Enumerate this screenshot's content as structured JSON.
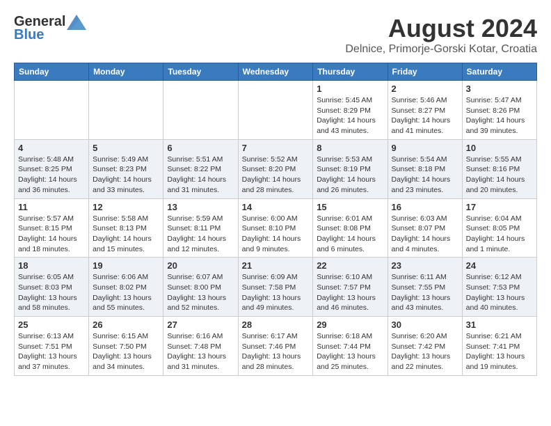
{
  "header": {
    "logo": {
      "general": "General",
      "blue": "Blue"
    },
    "title": "August 2024",
    "location": "Delnice, Primorje-Gorski Kotar, Croatia"
  },
  "days_of_week": [
    "Sunday",
    "Monday",
    "Tuesday",
    "Wednesday",
    "Thursday",
    "Friday",
    "Saturday"
  ],
  "weeks": [
    {
      "days": [
        {
          "date": "",
          "info": ""
        },
        {
          "date": "",
          "info": ""
        },
        {
          "date": "",
          "info": ""
        },
        {
          "date": "",
          "info": ""
        },
        {
          "date": "1",
          "sunrise": "Sunrise: 5:45 AM",
          "sunset": "Sunset: 8:29 PM",
          "daylight": "Daylight: 14 hours and 43 minutes."
        },
        {
          "date": "2",
          "sunrise": "Sunrise: 5:46 AM",
          "sunset": "Sunset: 8:27 PM",
          "daylight": "Daylight: 14 hours and 41 minutes."
        },
        {
          "date": "3",
          "sunrise": "Sunrise: 5:47 AM",
          "sunset": "Sunset: 8:26 PM",
          "daylight": "Daylight: 14 hours and 39 minutes."
        }
      ]
    },
    {
      "days": [
        {
          "date": "4",
          "sunrise": "Sunrise: 5:48 AM",
          "sunset": "Sunset: 8:25 PM",
          "daylight": "Daylight: 14 hours and 36 minutes."
        },
        {
          "date": "5",
          "sunrise": "Sunrise: 5:49 AM",
          "sunset": "Sunset: 8:23 PM",
          "daylight": "Daylight: 14 hours and 33 minutes."
        },
        {
          "date": "6",
          "sunrise": "Sunrise: 5:51 AM",
          "sunset": "Sunset: 8:22 PM",
          "daylight": "Daylight: 14 hours and 31 minutes."
        },
        {
          "date": "7",
          "sunrise": "Sunrise: 5:52 AM",
          "sunset": "Sunset: 8:20 PM",
          "daylight": "Daylight: 14 hours and 28 minutes."
        },
        {
          "date": "8",
          "sunrise": "Sunrise: 5:53 AM",
          "sunset": "Sunset: 8:19 PM",
          "daylight": "Daylight: 14 hours and 26 minutes."
        },
        {
          "date": "9",
          "sunrise": "Sunrise: 5:54 AM",
          "sunset": "Sunset: 8:18 PM",
          "daylight": "Daylight: 14 hours and 23 minutes."
        },
        {
          "date": "10",
          "sunrise": "Sunrise: 5:55 AM",
          "sunset": "Sunset: 8:16 PM",
          "daylight": "Daylight: 14 hours and 20 minutes."
        }
      ]
    },
    {
      "days": [
        {
          "date": "11",
          "sunrise": "Sunrise: 5:57 AM",
          "sunset": "Sunset: 8:15 PM",
          "daylight": "Daylight: 14 hours and 18 minutes."
        },
        {
          "date": "12",
          "sunrise": "Sunrise: 5:58 AM",
          "sunset": "Sunset: 8:13 PM",
          "daylight": "Daylight: 14 hours and 15 minutes."
        },
        {
          "date": "13",
          "sunrise": "Sunrise: 5:59 AM",
          "sunset": "Sunset: 8:11 PM",
          "daylight": "Daylight: 14 hours and 12 minutes."
        },
        {
          "date": "14",
          "sunrise": "Sunrise: 6:00 AM",
          "sunset": "Sunset: 8:10 PM",
          "daylight": "Daylight: 14 hours and 9 minutes."
        },
        {
          "date": "15",
          "sunrise": "Sunrise: 6:01 AM",
          "sunset": "Sunset: 8:08 PM",
          "daylight": "Daylight: 14 hours and 6 minutes."
        },
        {
          "date": "16",
          "sunrise": "Sunrise: 6:03 AM",
          "sunset": "Sunset: 8:07 PM",
          "daylight": "Daylight: 14 hours and 4 minutes."
        },
        {
          "date": "17",
          "sunrise": "Sunrise: 6:04 AM",
          "sunset": "Sunset: 8:05 PM",
          "daylight": "Daylight: 14 hours and 1 minute."
        }
      ]
    },
    {
      "days": [
        {
          "date": "18",
          "sunrise": "Sunrise: 6:05 AM",
          "sunset": "Sunset: 8:03 PM",
          "daylight": "Daylight: 13 hours and 58 minutes."
        },
        {
          "date": "19",
          "sunrise": "Sunrise: 6:06 AM",
          "sunset": "Sunset: 8:02 PM",
          "daylight": "Daylight: 13 hours and 55 minutes."
        },
        {
          "date": "20",
          "sunrise": "Sunrise: 6:07 AM",
          "sunset": "Sunset: 8:00 PM",
          "daylight": "Daylight: 13 hours and 52 minutes."
        },
        {
          "date": "21",
          "sunrise": "Sunrise: 6:09 AM",
          "sunset": "Sunset: 7:58 PM",
          "daylight": "Daylight: 13 hours and 49 minutes."
        },
        {
          "date": "22",
          "sunrise": "Sunrise: 6:10 AM",
          "sunset": "Sunset: 7:57 PM",
          "daylight": "Daylight: 13 hours and 46 minutes."
        },
        {
          "date": "23",
          "sunrise": "Sunrise: 6:11 AM",
          "sunset": "Sunset: 7:55 PM",
          "daylight": "Daylight: 13 hours and 43 minutes."
        },
        {
          "date": "24",
          "sunrise": "Sunrise: 6:12 AM",
          "sunset": "Sunset: 7:53 PM",
          "daylight": "Daylight: 13 hours and 40 minutes."
        }
      ]
    },
    {
      "days": [
        {
          "date": "25",
          "sunrise": "Sunrise: 6:13 AM",
          "sunset": "Sunset: 7:51 PM",
          "daylight": "Daylight: 13 hours and 37 minutes."
        },
        {
          "date": "26",
          "sunrise": "Sunrise: 6:15 AM",
          "sunset": "Sunset: 7:50 PM",
          "daylight": "Daylight: 13 hours and 34 minutes."
        },
        {
          "date": "27",
          "sunrise": "Sunrise: 6:16 AM",
          "sunset": "Sunset: 7:48 PM",
          "daylight": "Daylight: 13 hours and 31 minutes."
        },
        {
          "date": "28",
          "sunrise": "Sunrise: 6:17 AM",
          "sunset": "Sunset: 7:46 PM",
          "daylight": "Daylight: 13 hours and 28 minutes."
        },
        {
          "date": "29",
          "sunrise": "Sunrise: 6:18 AM",
          "sunset": "Sunset: 7:44 PM",
          "daylight": "Daylight: 13 hours and 25 minutes."
        },
        {
          "date": "30",
          "sunrise": "Sunrise: 6:20 AM",
          "sunset": "Sunset: 7:42 PM",
          "daylight": "Daylight: 13 hours and 22 minutes."
        },
        {
          "date": "31",
          "sunrise": "Sunrise: 6:21 AM",
          "sunset": "Sunset: 7:41 PM",
          "daylight": "Daylight: 13 hours and 19 minutes."
        }
      ]
    }
  ]
}
